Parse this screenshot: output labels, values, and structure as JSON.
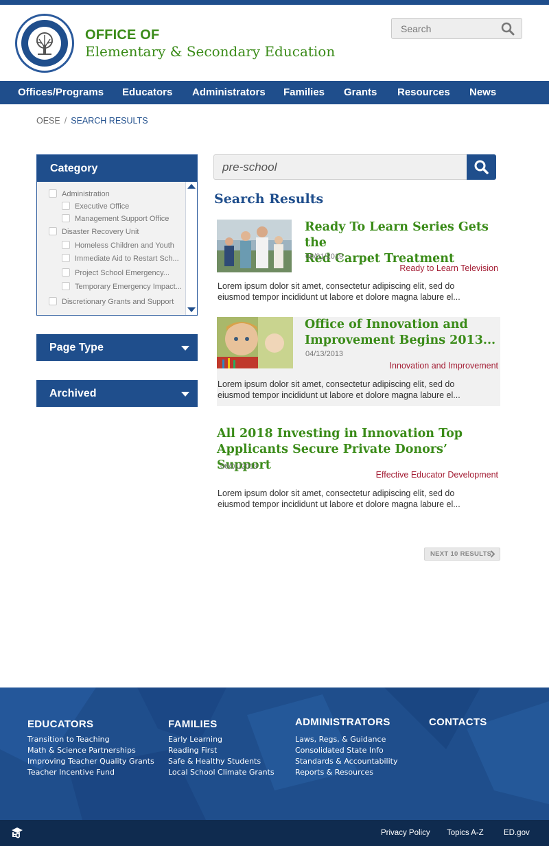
{
  "header": {
    "title_line1": "OFFICE OF",
    "title_line2": "Elementary & Secondary Education",
    "search_placeholder": "Search"
  },
  "nav": {
    "items": [
      "Offices/Programs",
      "Educators",
      "Administrators",
      "Families",
      "Grants",
      "Resources",
      "News"
    ]
  },
  "breadcrumb": {
    "root": "OESE",
    "separator": "/",
    "current": "SEARCH RESULTS"
  },
  "sidebar": {
    "category_title": "Category",
    "category_items": [
      "Administration",
      "Executive Office",
      "Management Support Office",
      "Disaster Recovery Unit",
      "Homeless Children and Youth",
      "Immediate Aid to Restart Sch...",
      "Project School Emergency...",
      "Temporary Emergency Impact...",
      "Discretionary Grants and Support"
    ],
    "page_type_title": "Page Type",
    "archived_title": "Archived"
  },
  "search": {
    "query": "pre-school"
  },
  "results": {
    "heading": "Search Results",
    "items": [
      {
        "title_line1": "Ready To Learn Series Gets the",
        "title_line2": "Red Carpet Treatment",
        "date": "06/01/2019",
        "category": "Ready to Learn Television",
        "snippet_line1": "Lorem ipsum dolor sit amet, consectetur adipiscing elit, sed do",
        "snippet_line2": "eiusmod tempor incididunt ut labore et dolore magna labure el..."
      },
      {
        "title_line1": "Office of Innovation and",
        "title_line2": "Improvement Begins 2013...",
        "date": "04/13/2013",
        "category": "Innovation and Improvement",
        "snippet_line1": "Lorem ipsum dolor sit amet, consectetur adipiscing elit, sed do",
        "snippet_line2": "eiusmod tempor incididunt ut labore et dolore magna labure el..."
      },
      {
        "title_line1": "All 2018 Investing in Innovation Top",
        "title_line2": "Applicants Secure Private Donors’ Support",
        "date": "06/01/2019",
        "category": "Effective Educator Development",
        "snippet_line1": "Lorem ipsum dolor sit amet, consectetur adipiscing elit, sed do",
        "snippet_line2": "eiusmod tempor incididunt ut labore et dolore magna labure el..."
      }
    ],
    "next_label": "NEXT 10 RESULTS"
  },
  "footer": {
    "educators": {
      "title": "EDUCATORS",
      "links": [
        "Transition to Teaching",
        "Math & Science Partnerships",
        "Improving Teacher Quality Grants",
        "Teacher Incentive Fund"
      ]
    },
    "families": {
      "title": "FAMILIES",
      "links": [
        "Early Learning",
        "Reading First",
        "Safe & Healthy Students",
        "Local School Climate Grants"
      ]
    },
    "administrators": {
      "title": "ADMINISTRATORS",
      "links": [
        "Laws, Regs, & Guidance",
        "Consolidated State Info",
        "Standards & Accountability",
        "Reports & Resources"
      ]
    },
    "contacts": {
      "title": "CONTACTS"
    },
    "bottom_links": [
      "Privacy Policy",
      "Topics A-Z",
      "ED.gov"
    ]
  },
  "colors": {
    "brand_blue": "#1f4e8c",
    "title_green": "#3a8b18",
    "category_red": "#a31c33",
    "footer_dark": "#0f2b4f"
  },
  "icons": [
    "seal-logo",
    "search-icon",
    "checkbox",
    "caret-down-icon",
    "chevron-right-icon",
    "ed-logo-icon"
  ]
}
